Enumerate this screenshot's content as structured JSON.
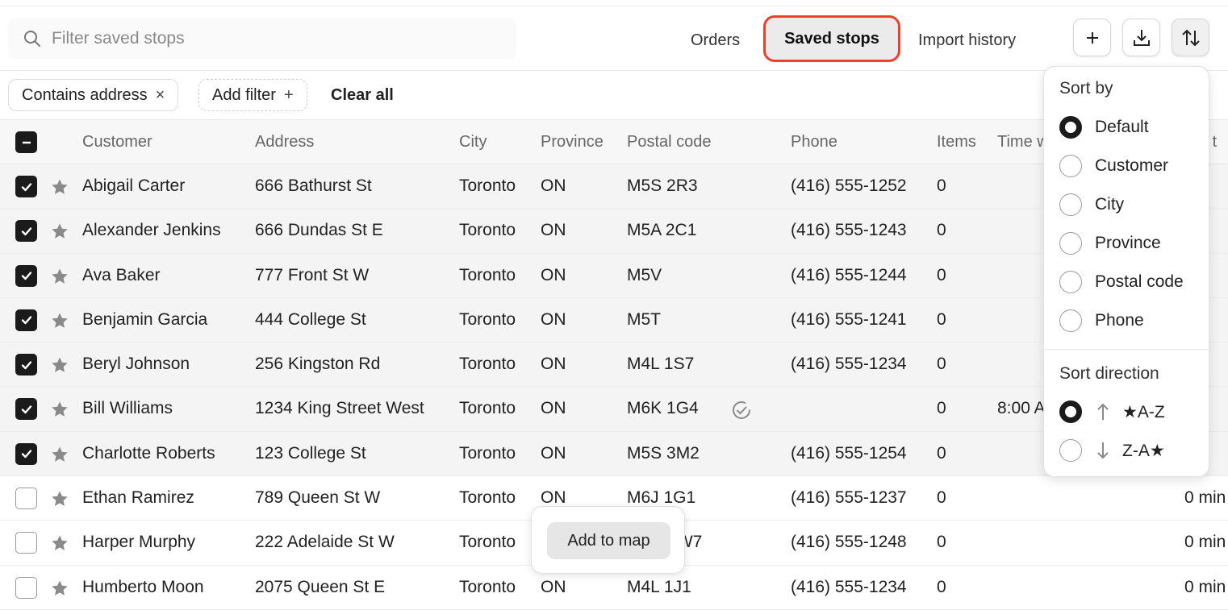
{
  "search": {
    "placeholder": "Filter saved stops"
  },
  "tabs": [
    {
      "label": "Orders"
    },
    {
      "label": "Saved stops"
    },
    {
      "label": "Import history"
    }
  ],
  "filters": {
    "chip": "Contains address",
    "chip_close": "×",
    "add": "Add filter",
    "add_icon": "+",
    "clear": "Clear all"
  },
  "columns": [
    "Customer",
    "Address",
    "City",
    "Province",
    "Postal code",
    "Phone",
    "Items",
    "Time w",
    "p t"
  ],
  "rows": [
    {
      "customer": "Abigail Carter",
      "address": "666 Bathurst St",
      "city": "Toronto",
      "province": "ON",
      "postal": "M5S 2R3",
      "phone": "(416) 555-1252",
      "items": "0",
      "time": "",
      "duration": "nin",
      "checked": true
    },
    {
      "customer": "Alexander Jenkins",
      "address": "666 Dundas St E",
      "city": "Toronto",
      "province": "ON",
      "postal": "M5A 2C1",
      "phone": "(416) 555-1243",
      "items": "0",
      "time": "",
      "duration": "nin",
      "checked": true
    },
    {
      "customer": "Ava Baker",
      "address": "777 Front St W",
      "city": "Toronto",
      "province": "ON",
      "postal": "M5V",
      "phone": "(416) 555-1244",
      "items": "0",
      "time": "",
      "duration": "nin",
      "checked": true
    },
    {
      "customer": "Benjamin Garcia",
      "address": "444 College St",
      "city": "Toronto",
      "province": "ON",
      "postal": "M5T",
      "phone": "(416) 555-1241",
      "items": "0",
      "time": "",
      "duration": "nin",
      "checked": true
    },
    {
      "customer": "Beryl Johnson",
      "address": "256 Kingston Rd",
      "city": "Toronto",
      "province": "ON",
      "postal": "M4L 1S7",
      "phone": "(416) 555-1234",
      "items": "0",
      "time": "",
      "duration": "nin",
      "checked": true
    },
    {
      "customer": "Bill Williams",
      "address": "1234 King Street West",
      "city": "Toronto",
      "province": "ON",
      "postal": "M6K 1G4",
      "phone": "",
      "items": "0",
      "time": "8:00 A",
      "duration": "nin",
      "checked": true,
      "verified": true
    },
    {
      "customer": "Charlotte Roberts",
      "address": "123 College St",
      "city": "Toronto",
      "province": "ON",
      "postal": "M5S 3M2",
      "phone": "(416) 555-1254",
      "items": "0",
      "time": "",
      "duration": "nin",
      "checked": true
    },
    {
      "customer": "Ethan Ramirez",
      "address": "789 Queen St W",
      "city": "Toronto",
      "province": "ON",
      "postal": "M6J 1G1",
      "phone": "(416) 555-1237",
      "items": "0",
      "time": "",
      "duration": "0 min",
      "checked": false
    },
    {
      "customer": "Harper Murphy",
      "address": "222 Adelaide St W",
      "city": "Toronto",
      "province": "ON",
      "postal": "M5H 1W7",
      "phone": "(416) 555-1248",
      "items": "0",
      "time": "",
      "duration": "0 min",
      "checked": false
    },
    {
      "customer": "Humberto Moon",
      "address": "2075 Queen St E",
      "city": "Toronto",
      "province": "ON",
      "postal": "M4L 1J1",
      "phone": "(416) 555-1234",
      "items": "0",
      "time": "",
      "duration": "0 min",
      "checked": false
    }
  ],
  "sort": {
    "title": "Sort by",
    "options": [
      "Default",
      "Customer",
      "City",
      "Province",
      "Postal code",
      "Phone"
    ],
    "selected": "Default",
    "direction_title": "Sort direction",
    "directions": [
      "★A-Z",
      "Z-A★"
    ],
    "direction_selected": "★A-Z"
  },
  "add_to_map": "Add to map",
  "colors": {
    "accent_outline": "#e8412e",
    "checkbox_on": "#1b1b1b",
    "selected_row": "#f4f4f4"
  }
}
